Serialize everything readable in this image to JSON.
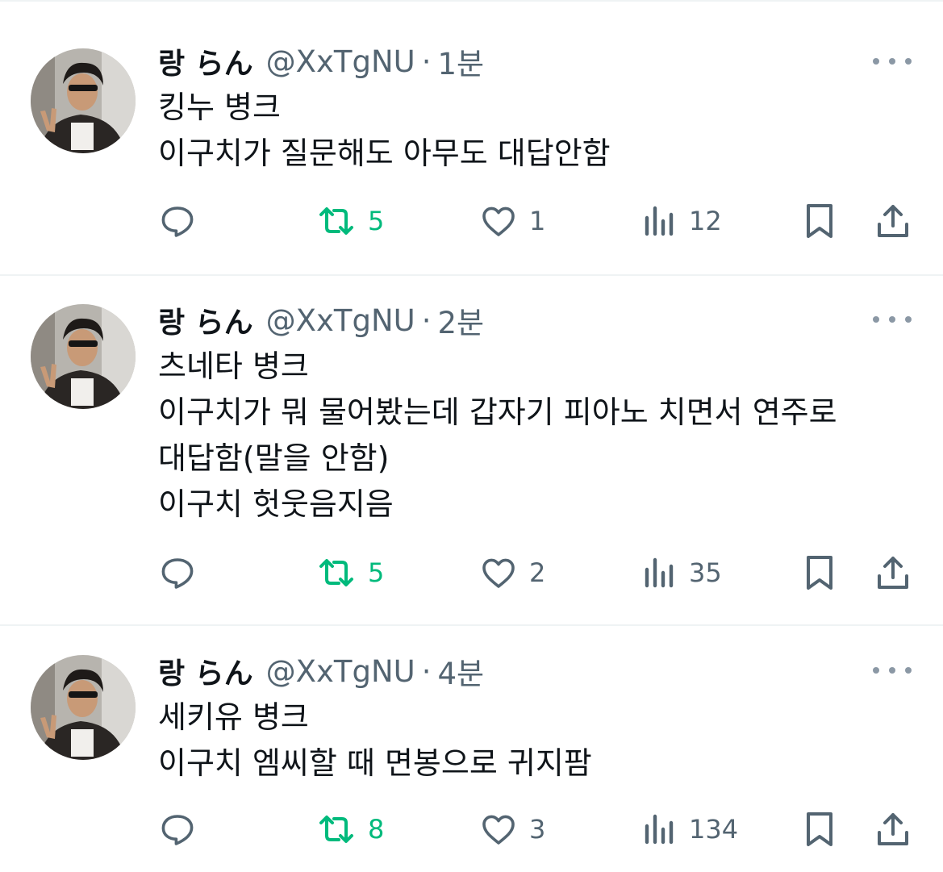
{
  "tweets": [
    {
      "name": "랑 らん",
      "handle": "@XxTgNU",
      "separator": "·",
      "time": "1분",
      "lines": [
        "킹누 병크",
        "이구치가 질문해도 아무도 대답안함"
      ],
      "retweets": "5",
      "likes": "1",
      "views": "12"
    },
    {
      "name": "랑 らん",
      "handle": "@XxTgNU",
      "separator": "·",
      "time": "2분",
      "lines": [
        "츠네타 병크",
        "이구치가 뭐 물어봤는데 갑자기 피아노 치면서 연주로",
        "대답함(말을 안함)",
        "이구치 헛웃음지음"
      ],
      "retweets": "5",
      "likes": "2",
      "views": "35"
    },
    {
      "name": "랑 らん",
      "handle": "@XxTgNU",
      "separator": "·",
      "time": "4분",
      "lines": [
        "세키유 병크",
        "이구치 엠씨할 때 면봉으로 귀지팜"
      ],
      "retweets": "8",
      "likes": "3",
      "views": "134"
    }
  ],
  "icons": {
    "reply": "reply-icon",
    "retweet": "retweet-icon",
    "like": "heart-icon",
    "views": "views-icon",
    "bookmark": "bookmark-icon",
    "share": "share-icon",
    "more": "more-icon"
  },
  "colors": {
    "text": "#0f1419",
    "secondary": "#536471",
    "retweet_green": "#00ba7c",
    "divider": "#eff3f4"
  }
}
